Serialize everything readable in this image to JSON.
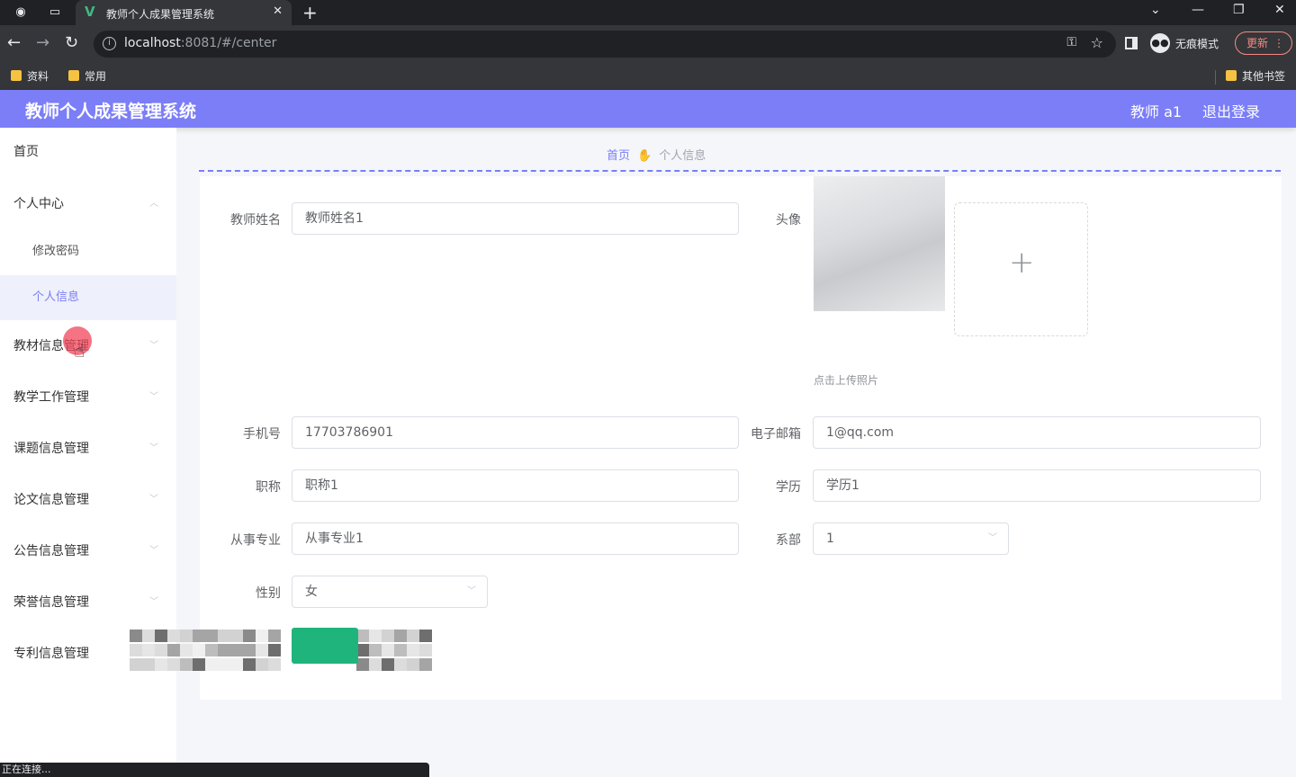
{
  "browser": {
    "tab_title": "教师个人成果管理系统",
    "url_host": "localhost",
    "url_rest": ":8081/#/center",
    "incognito_label": "无痕模式",
    "update_label": "更新",
    "bookmarks": [
      "资料",
      "常用"
    ],
    "other_bookmarks": "其他书签",
    "status_text": "正在连接..."
  },
  "header": {
    "title": "教师个人成果管理系统",
    "user": "教师 a1",
    "logout": "退出登录",
    "accent_color": "#7b7ef6"
  },
  "sidebar": {
    "items": [
      {
        "label": "首页"
      },
      {
        "label": "个人中心"
      },
      {
        "label": "修改密码"
      },
      {
        "label": "个人信息"
      },
      {
        "label": "教材信息管理"
      },
      {
        "label": "教学工作管理"
      },
      {
        "label": "课题信息管理"
      },
      {
        "label": "论文信息管理"
      },
      {
        "label": "公告信息管理"
      },
      {
        "label": "荣誉信息管理"
      },
      {
        "label": "专利信息管理"
      }
    ]
  },
  "breadcrumb": {
    "home": "首页",
    "current": "个人信息"
  },
  "form": {
    "name_label": "教师姓名",
    "name_value": "教师姓名1",
    "avatar_label": "头像",
    "upload_hint": "点击上传照片",
    "phone_label": "手机号",
    "phone_value": "17703786901",
    "email_label": "电子邮箱",
    "email_value": "1@qq.com",
    "title_label": "职称",
    "title_value": "职称1",
    "edu_label": "学历",
    "edu_value": "学历1",
    "major_label": "从事专业",
    "major_value": "从事专业1",
    "dept_label": "系部",
    "dept_value": "1",
    "gender_label": "性别",
    "gender_value": "女"
  }
}
